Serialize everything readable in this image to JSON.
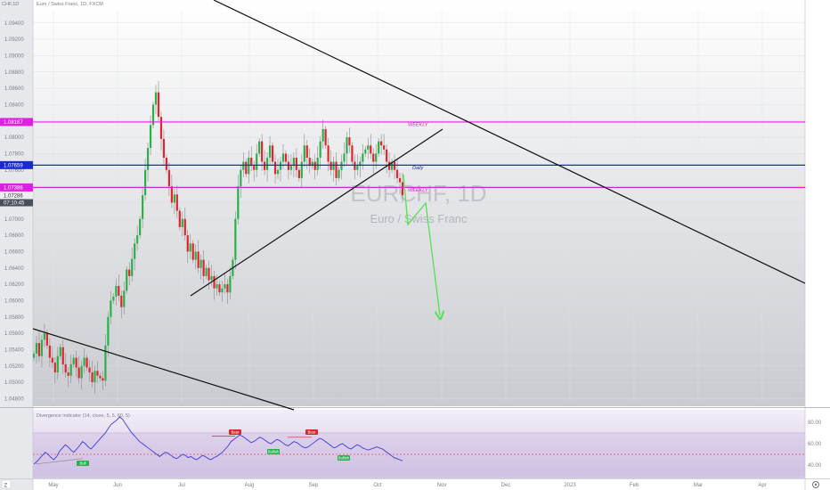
{
  "header": {
    "symbol_label": "CHF,1D",
    "chart_title": "Euro / Swiss Franc, 1D, FXCM"
  },
  "watermark": {
    "symbol": "EURCHF, 1D",
    "name": "Euro / Swiss Franc"
  },
  "colors": {
    "up": "#2ab04a",
    "down": "#e0262d",
    "wick": "#8a8a8a",
    "magenta": "#e020e0",
    "blue": "#1a2ad0",
    "trend": "#111111",
    "arrow": "#55e055",
    "oscillator": "#3b3bd6"
  },
  "chart_data": [
    {
      "type": "candlestick",
      "title": "Euro / Swiss Franc, 1D, FXCM",
      "y_axis": {
        "side": "right",
        "ticks": [
          "1.09400",
          "1.09200",
          "1.09000",
          "1.08800",
          "1.08600",
          "1.08400",
          "1.08200",
          "1.08000",
          "1.07800",
          "1.07600",
          "1.07400",
          "1.07200",
          "1.07000",
          "1.06800",
          "1.06600",
          "1.06400",
          "1.06200",
          "1.06000",
          "1.05800",
          "1.05600",
          "1.05400",
          "1.05200",
          "1.05000",
          "1.04800"
        ],
        "ylim": [
          1.0475,
          1.0955
        ]
      },
      "x_axis": {
        "ticks": [
          "May",
          "Jun",
          "Jul",
          "Aug",
          "Sep",
          "Oct",
          "Nov",
          "Dec",
          "2023",
          "Feb",
          "Mar",
          "Apr"
        ]
      },
      "price_levels": [
        {
          "label": "WEEKLY",
          "price_tag": "1.08187",
          "value": 1.08187,
          "color": "#e020e0"
        },
        {
          "label": "Daily",
          "price_tag": "1.07659",
          "value": 1.07659,
          "color": "#1a2ad0"
        },
        {
          "label": "WEEKLY",
          "price_tag": "1.07386",
          "value": 1.07386,
          "color": "#e020e0"
        }
      ],
      "last_price": {
        "value": "1.07286",
        "countdown": "07:10:45"
      },
      "series_approx_close": [
        1.0535,
        1.0548,
        1.0532,
        1.0552,
        1.056,
        1.0545,
        1.053,
        1.0524,
        1.0512,
        1.0532,
        1.0543,
        1.0522,
        1.0512,
        1.0508,
        1.0522,
        1.053,
        1.0518,
        1.0505,
        1.052,
        1.053,
        1.0518,
        1.0512,
        1.05,
        1.0514,
        1.0508,
        1.0505,
        1.0502,
        1.0545,
        1.058,
        1.06,
        1.0605,
        1.0618,
        1.0606,
        1.0592,
        1.0612,
        1.0638,
        1.063,
        1.0651,
        1.067,
        1.068,
        1.07,
        1.0729,
        1.076,
        1.0787,
        1.0815,
        1.084,
        1.0855,
        1.0825,
        1.0798,
        1.0775,
        1.076,
        1.074,
        1.072,
        1.073,
        1.071,
        1.069,
        1.07,
        1.068,
        1.066,
        1.067,
        1.065,
        1.066,
        1.064,
        1.065,
        1.063,
        1.064,
        1.0625,
        1.063,
        1.0615,
        1.062,
        1.061,
        1.0615,
        1.062,
        1.061,
        1.063,
        1.065,
        1.07,
        1.074,
        1.076,
        1.077,
        1.0755,
        1.0775,
        1.0765,
        1.076,
        1.078,
        1.0795,
        1.077,
        1.076,
        1.0775,
        1.079,
        1.077,
        1.0755,
        1.076,
        1.077,
        1.078,
        1.077,
        1.076,
        1.0765,
        1.0775,
        1.076,
        1.075,
        1.077,
        1.079,
        1.0775,
        1.0765,
        1.077,
        1.076,
        1.0775,
        1.0795,
        1.081,
        1.079,
        1.077,
        1.076,
        1.077,
        1.075,
        1.076,
        1.077,
        1.078,
        1.08,
        1.079,
        1.077,
        1.076,
        1.0765,
        1.077,
        1.078,
        1.0785,
        1.079,
        1.078,
        1.077,
        1.078,
        1.0795,
        1.079,
        1.0785,
        1.077,
        1.076,
        1.077,
        1.076,
        1.075,
        1.0745,
        1.0729
      ]
    },
    {
      "type": "line",
      "title": "Divergence indicator (14, close, 5, 5, 60, 5)",
      "y_axis": {
        "ticks": [
          "80.00",
          "60.00",
          "40.00"
        ],
        "ylim": [
          30,
          90
        ]
      },
      "bands": {
        "upper": 70,
        "lower": 30,
        "mid": 50
      },
      "labels": [
        "Bull",
        "Bear",
        "Bullish",
        "Bear",
        "Bullish"
      ],
      "series_approx": [
        41,
        43,
        46,
        49,
        52,
        50,
        47,
        45,
        48,
        53,
        56,
        59,
        57,
        54,
        52,
        55,
        58,
        62,
        60,
        57,
        55,
        58,
        61,
        64,
        67,
        70,
        74,
        78,
        80,
        82,
        85,
        83,
        79,
        75,
        71,
        68,
        65,
        62,
        60,
        58,
        56,
        54,
        52,
        50,
        48,
        50,
        52,
        51,
        49,
        47,
        46,
        48,
        50,
        49,
        47,
        48,
        46,
        45,
        47,
        49,
        48,
        46,
        45,
        47,
        48,
        50,
        52,
        55,
        58,
        62,
        64,
        66,
        68,
        67,
        65,
        63,
        61,
        62,
        64,
        66,
        65,
        63,
        61,
        60,
        62,
        64,
        63,
        61,
        59,
        58,
        60,
        62,
        61,
        59,
        57,
        56,
        57,
        59,
        61,
        63,
        65,
        64,
        62,
        60,
        58,
        56,
        57,
        59,
        60,
        58,
        56,
        55,
        57,
        59,
        58,
        56,
        55,
        54,
        55,
        56,
        57,
        56,
        55,
        53,
        51,
        49,
        47,
        46,
        45,
        44
      ]
    }
  ],
  "axis_buttons": {
    "scale_mode": "Z",
    "gear": "gear-icon"
  }
}
